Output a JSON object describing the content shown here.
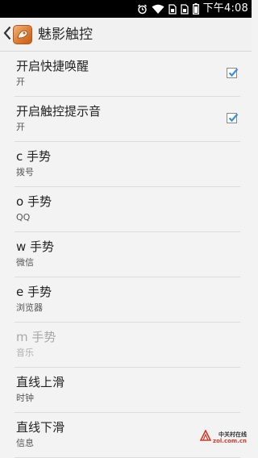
{
  "status_bar": {
    "time": "下午4:08",
    "icons": [
      "alarm-icon",
      "wifi-icon",
      "sim-card-icon",
      "sim-card-icon",
      "battery-icon"
    ]
  },
  "action_bar": {
    "title": "魅影触控"
  },
  "settings": [
    {
      "label": "开启快捷唤醒",
      "summary": "开",
      "checked": true,
      "enabled": true
    },
    {
      "label": "开启触控提示音",
      "summary": "开",
      "checked": true,
      "enabled": true
    },
    {
      "label": "c 手势",
      "summary": "拨号",
      "enabled": true
    },
    {
      "label": "o 手势",
      "summary": "QQ",
      "enabled": true
    },
    {
      "label": "w 手势",
      "summary": "微信",
      "enabled": true
    },
    {
      "label": "e 手势",
      "summary": "浏览器",
      "enabled": true
    },
    {
      "label": "m 手势",
      "summary": "音乐",
      "enabled": false
    },
    {
      "label": "直线上滑",
      "summary": "时钟",
      "enabled": true
    },
    {
      "label": "直线下滑",
      "summary": "信息",
      "enabled": true
    }
  ],
  "watermark": {
    "name": "中关村在线",
    "domain": "zol.com.cn"
  },
  "colors": {
    "checkmark": "#3a8fd6",
    "background": "#f3f3f3",
    "status_bar": "#000000"
  }
}
